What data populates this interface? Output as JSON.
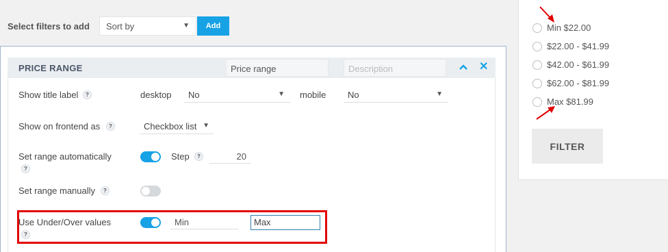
{
  "filter_bar": {
    "label": "Select filters to add",
    "sort_placeholder": "Sort by",
    "add_label": "Add"
  },
  "price_range": {
    "title": "PRICE RANGE",
    "title_input_value": "Price range",
    "description_placeholder": "Description",
    "rows": {
      "show_title_label": {
        "label": "Show title label",
        "desktop_label": "desktop",
        "desktop_value": "No",
        "mobile_label": "mobile",
        "mobile_value": "No"
      },
      "show_on_frontend": {
        "label": "Show on frontend as",
        "value": "Checkbox list"
      },
      "set_range_auto": {
        "label": "Set range automatically",
        "toggle_on": true,
        "step_label": "Step",
        "step_value": "20"
      },
      "set_range_manual": {
        "label": "Set range manually",
        "toggle_on": false
      },
      "under_over": {
        "label": "Use Under/Over values",
        "toggle_on": true,
        "min_value": "Min",
        "max_value": "Max"
      }
    }
  },
  "help_glyph": "?",
  "widget": {
    "options": [
      "Min $22.00",
      "$22.00 - $41.99",
      "$42.00 - $61.99",
      "$62.00 - $81.99",
      "Max $81.99"
    ],
    "filter_label": "FILTER"
  },
  "colors": {
    "accent": "#17a2e6",
    "highlight": "#e10000"
  }
}
